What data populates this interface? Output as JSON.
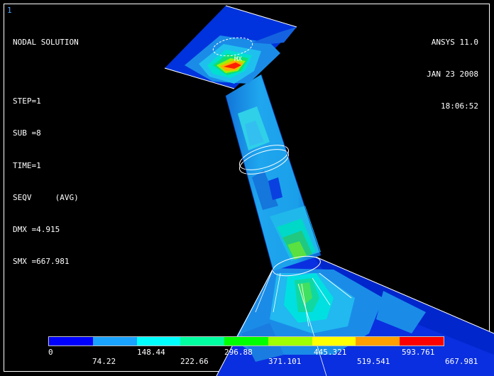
{
  "window": {
    "number": "1"
  },
  "result_info": {
    "title": "NODAL SOLUTION",
    "step": "STEP=1",
    "sub": "SUB =8",
    "time": "TIME=1",
    "quantity": "SEQV     (AVG)",
    "dmx": "DMX =4.915",
    "smx": "SMX =667.981"
  },
  "version_info": {
    "product": "ANSYS 11.0",
    "date": "JAN 23 2008",
    "time": "18:06:52"
  },
  "model": {
    "max_marker": "MX",
    "colors": {
      "background": "#000000",
      "pipe_base": "#1a8fe0",
      "pipe_light": "#2fb4f0",
      "plate_base": "#0033dd"
    }
  },
  "legend": {
    "colors": [
      "#0000ff",
      "#1aa2ff",
      "#00ffff",
      "#00ffa0",
      "#00ff00",
      "#a0ff00",
      "#ffff00",
      "#ffa000",
      "#ff0000"
    ],
    "top_labels": [
      "0",
      "148.44",
      "296.88",
      "445.321",
      "593.761"
    ],
    "bottom_labels": [
      "74.22",
      "222.66",
      "371.101",
      "519.541",
      "667.981"
    ]
  }
}
